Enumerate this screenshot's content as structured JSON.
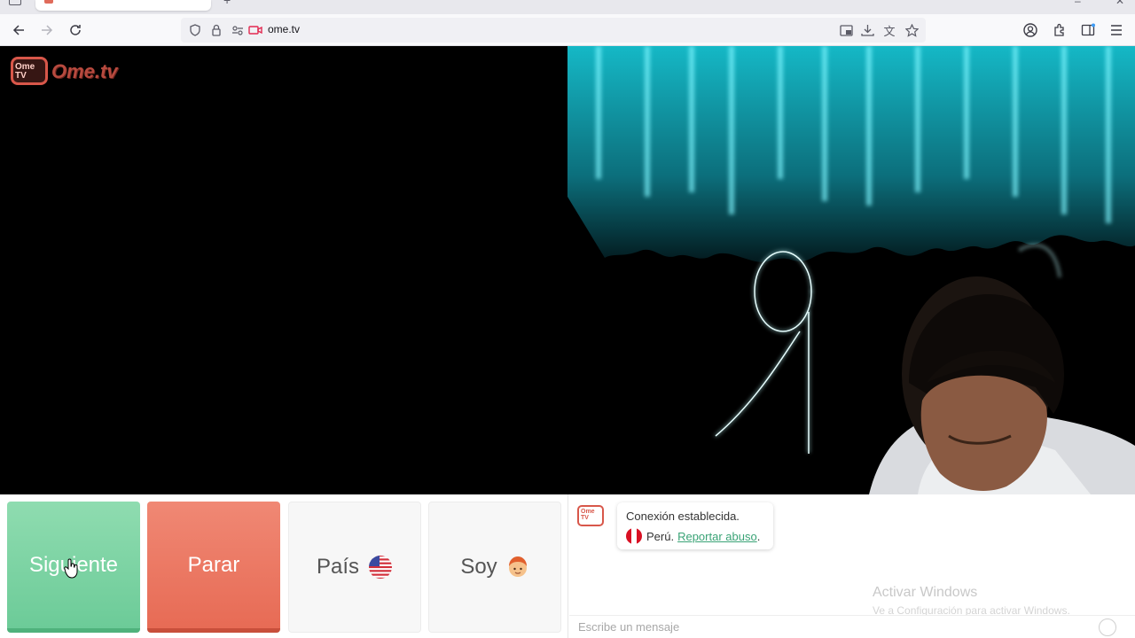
{
  "browser": {
    "url": "ome.tv"
  },
  "logo": {
    "badge_text": "Ome TV",
    "wordmark": "Ome.tv"
  },
  "controls": {
    "next_label": "Siguiente",
    "stop_label": "Parar",
    "country_label": "País",
    "country_flag": "us-flag-icon",
    "gender_label": "Soy",
    "gender_icon": "boy-avatar-icon"
  },
  "chat": {
    "status_text": "Conexión establecida.",
    "country_text": "Perú.",
    "report_link": "Reportar abuso",
    "report_suffix": ".",
    "message_placeholder": "Escribe un mensaje"
  },
  "watermark": {
    "line1": "Activar Windows",
    "line2": "Ve a Configuración para activar Windows."
  },
  "colors": {
    "next_green": "#6ccb98",
    "stop_red": "#e76b55",
    "brand": "#d8574a",
    "link_green": "#3aa376"
  }
}
